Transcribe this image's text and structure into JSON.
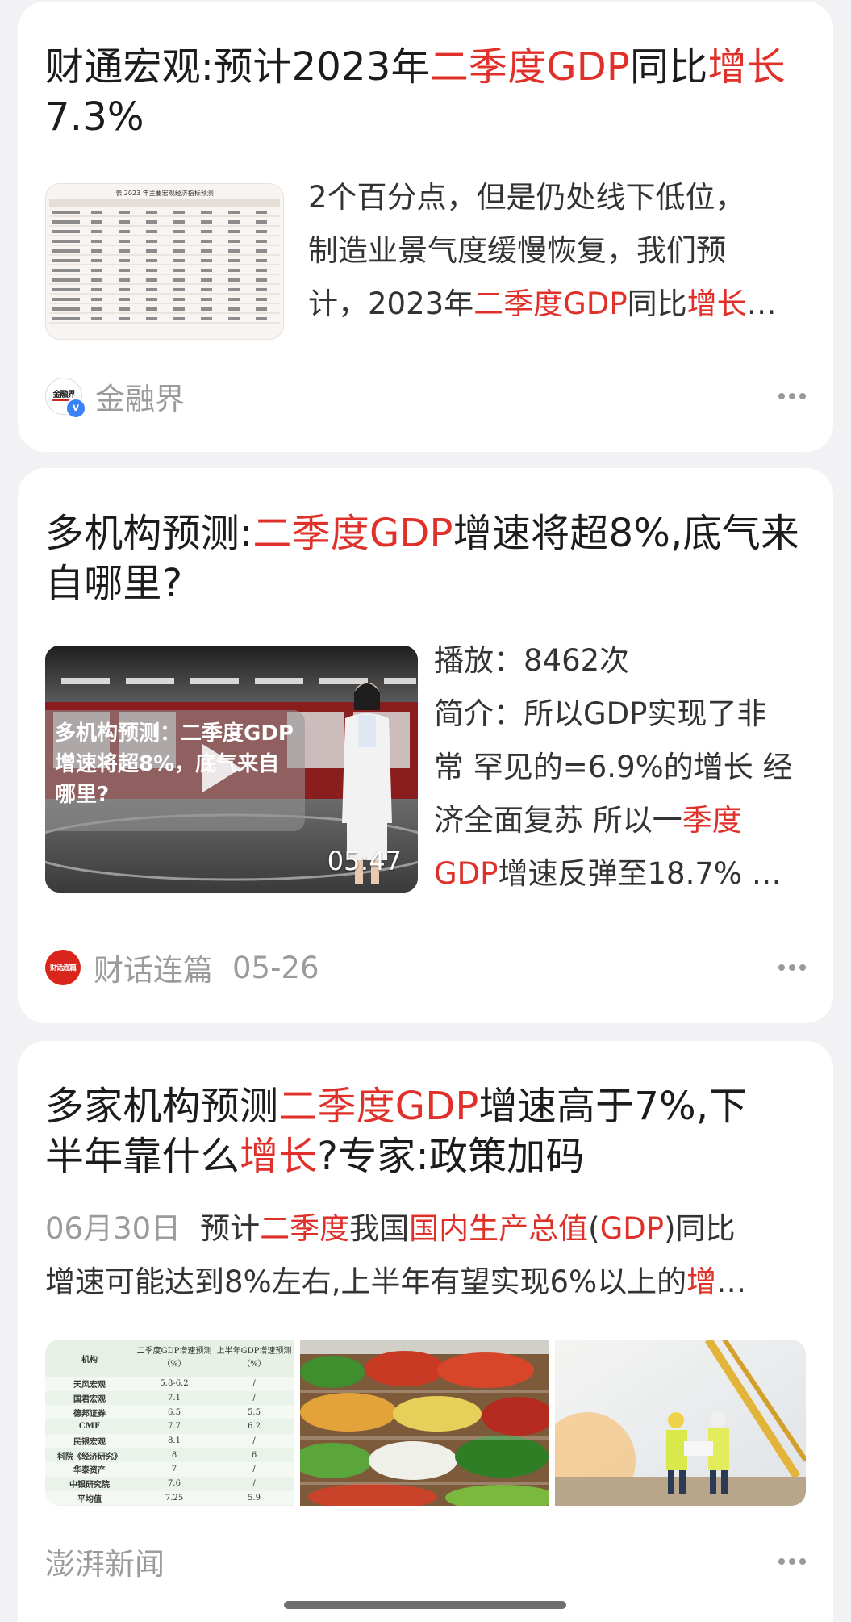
{
  "card1": {
    "title_parts": [
      "财通宏观:预计2023年",
      "二季度GDP",
      "同比",
      "增长",
      "7.3%"
    ],
    "snippet_line1": "2个百分点，但是仍处线下低位，",
    "snippet_line2": "制造业景气度缓慢恢复，我们预",
    "snippet_line3_parts": [
      "计，2023年",
      "二季度GDP",
      "同比",
      "增长",
      "…"
    ],
    "thumb_caption": "表 2023 年主要宏观经济指标预测",
    "source_name": "金融界",
    "avatar_text": "金融界",
    "more_icon": "more-horizontal-icon"
  },
  "card2": {
    "title_parts": [
      "多机构预测:",
      "二季度GDP",
      "增速将超8%,底气来自哪里?"
    ],
    "video_overlay_text": "多机构预测：二季度GDP增速将超8%，底气来自哪里?",
    "video_duration": "05:47",
    "play_count": "播放：8462次",
    "intro_line1": "简介：所以GDP实现了非",
    "intro_line2": "常 罕见的=6.9%的增长 经",
    "intro_line3_parts": [
      "济全面复苏 所以一",
      "季度"
    ],
    "intro_line4_parts": [
      "GDP",
      "增速反弹至18.7% …"
    ],
    "source_name": "财话连篇",
    "source_date": "05-26",
    "avatar_text": "财话连篇",
    "more_icon": "more-horizontal-icon"
  },
  "card3": {
    "title_line1_parts": [
      "多家机构预测",
      "二季度GDP",
      "增速高于7%,下"
    ],
    "title_line2_parts": [
      "半年靠什么",
      "增长",
      "?专家:政策加码"
    ],
    "date": "06月30日",
    "snippet_line1_parts": [
      "预计",
      "二季度",
      "我国",
      "国内生产总值",
      "(",
      "GDP",
      ")同比"
    ],
    "snippet_line2_parts": [
      "增速可能达到8%左右,上半年有望实现6%以上的",
      "增",
      "…"
    ],
    "table_headers": [
      "机构",
      "二季度GDP增速预测（%）",
      "上半年GDP增速预测（%）"
    ],
    "table_rows": [
      [
        "天风宏观",
        "5.8-6.2",
        "/"
      ],
      [
        "国君宏观",
        "7.1",
        "/"
      ],
      [
        "德邦证券",
        "6.5",
        "5.5"
      ],
      [
        "CMF",
        "7.7",
        "6.2"
      ],
      [
        "民银宏观",
        "8.1",
        "/"
      ],
      [
        "科院《经济研究》",
        "8",
        "6"
      ],
      [
        "华泰资产",
        "7",
        "/"
      ],
      [
        "中银研究院",
        "7.6",
        "/"
      ],
      [
        "平均值",
        "7.25",
        "5.9"
      ]
    ],
    "source_name": "澎湃新闻",
    "more_icon": "more-horizontal-icon"
  }
}
